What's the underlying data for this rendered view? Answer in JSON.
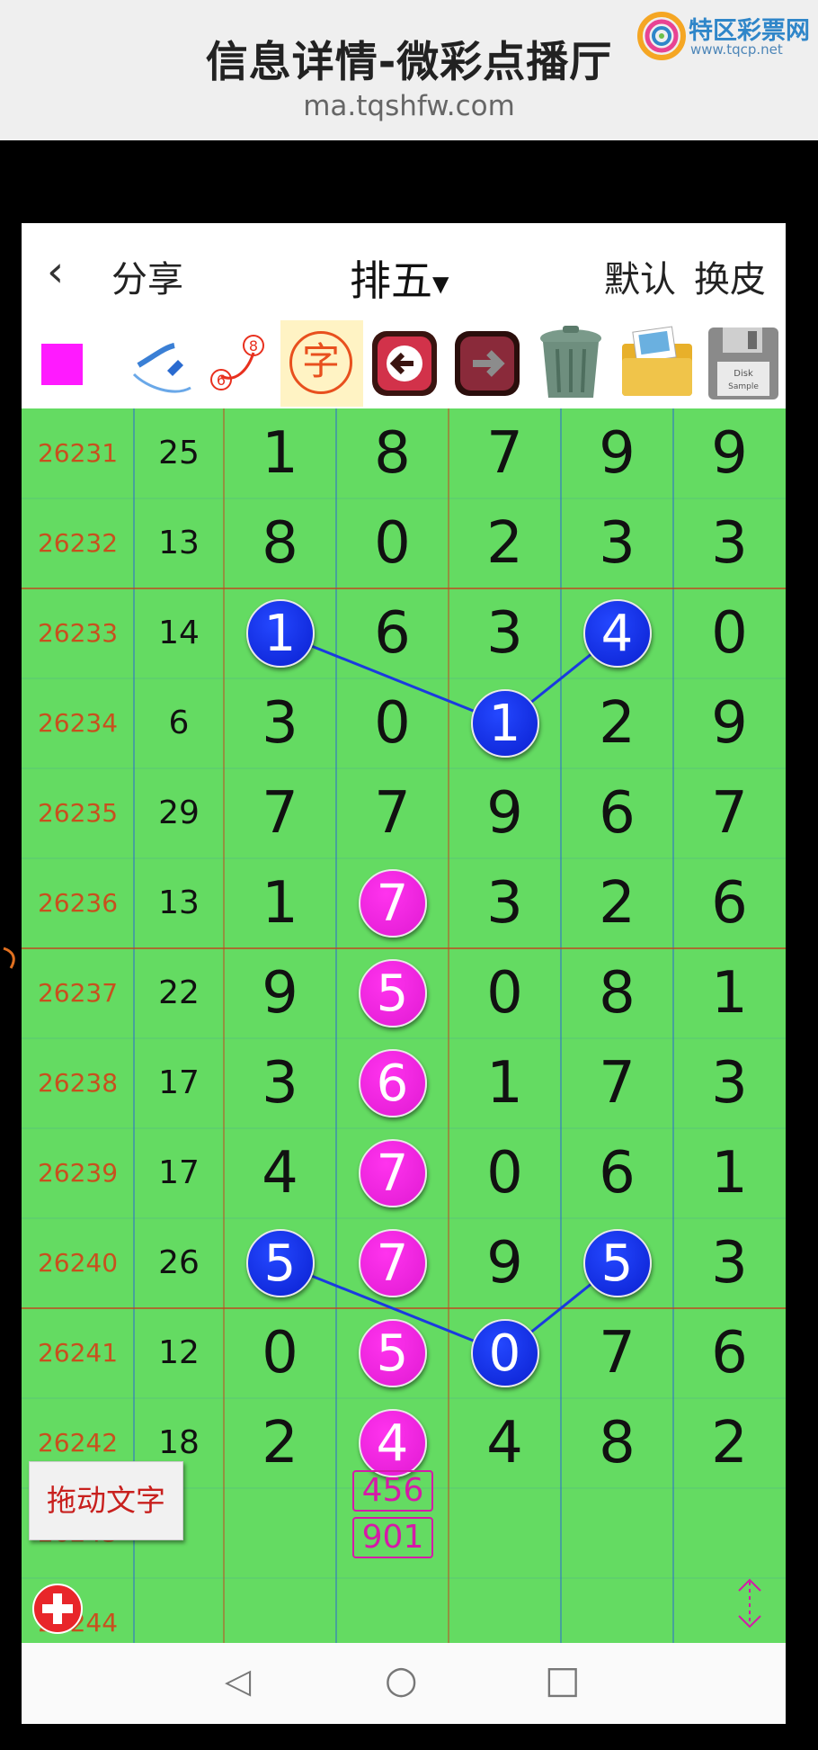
{
  "header": {
    "title": "信息详情-微彩点播厅",
    "url": "ma.tqshfw.com",
    "logo_name": "特区彩票网",
    "logo_url": "www.tqcp.net"
  },
  "nav": {
    "back_icon": "‹",
    "share": "分享",
    "title": "排五",
    "default": "默认",
    "skin": "换皮"
  },
  "toolbar": {
    "char_glyph": "字",
    "color_swatch": "#ff1aff",
    "curve_num_6": "6",
    "curve_num_8": "8",
    "floppy_label": "Disk",
    "floppy_sub": "Sample"
  },
  "grid": {
    "colors": {
      "bg": "#64db62",
      "issue": "#c8501e",
      "blue_ball": "#0a1fd0",
      "pink_ball": "#e01ad2",
      "row_line": "#c04a20",
      "col_line": "#2a6bd0"
    },
    "rows": [
      {
        "issue": "26231",
        "sum": "25",
        "digits": [
          "1",
          "8",
          "7",
          "9",
          "9"
        ]
      },
      {
        "issue": "26232",
        "sum": "13",
        "digits": [
          "8",
          "0",
          "2",
          "3",
          "3"
        ]
      },
      {
        "issue": "26233",
        "sum": "14",
        "digits": [
          "1",
          "6",
          "3",
          "4",
          "0"
        ]
      },
      {
        "issue": "26234",
        "sum": "6",
        "digits": [
          "3",
          "0",
          "1",
          "2",
          "9"
        ]
      },
      {
        "issue": "26235",
        "sum": "29",
        "digits": [
          "7",
          "7",
          "9",
          "6",
          "7"
        ]
      },
      {
        "issue": "26236",
        "sum": "13",
        "digits": [
          "1",
          "7",
          "3",
          "2",
          "6"
        ]
      },
      {
        "issue": "26237",
        "sum": "22",
        "digits": [
          "9",
          "5",
          "0",
          "8",
          "1"
        ]
      },
      {
        "issue": "26238",
        "sum": "17",
        "digits": [
          "3",
          "6",
          "1",
          "7",
          "3"
        ]
      },
      {
        "issue": "26239",
        "sum": "17",
        "digits": [
          "4",
          "7",
          "0",
          "6",
          "1"
        ]
      },
      {
        "issue": "26240",
        "sum": "26",
        "digits": [
          "5",
          "7",
          "9",
          "5",
          "3"
        ]
      },
      {
        "issue": "26241",
        "sum": "12",
        "digits": [
          "0",
          "5",
          "0",
          "7",
          "6"
        ]
      },
      {
        "issue": "26242",
        "sum": "18",
        "digits": [
          "2",
          "4",
          "4",
          "8",
          "2"
        ]
      },
      {
        "issue": "26243",
        "sum": "",
        "digits": [
          "",
          "",
          "",
          "",
          ""
        ]
      },
      {
        "issue": "26244",
        "sum": "",
        "digits": [
          "",
          "",
          "",
          "",
          ""
        ]
      }
    ],
    "balls": [
      {
        "row": 2,
        "col": 0,
        "color": "blue"
      },
      {
        "row": 3,
        "col": 2,
        "color": "blue"
      },
      {
        "row": 2,
        "col": 3,
        "color": "blue"
      },
      {
        "row": 5,
        "col": 1,
        "color": "pink"
      },
      {
        "row": 6,
        "col": 1,
        "color": "pink"
      },
      {
        "row": 7,
        "col": 1,
        "color": "pink"
      },
      {
        "row": 8,
        "col": 1,
        "color": "pink"
      },
      {
        "row": 9,
        "col": 1,
        "color": "pink"
      },
      {
        "row": 10,
        "col": 1,
        "color": "pink"
      },
      {
        "row": 11,
        "col": 1,
        "color": "pink"
      },
      {
        "row": 9,
        "col": 0,
        "color": "blue"
      },
      {
        "row": 10,
        "col": 2,
        "color": "blue"
      },
      {
        "row": 9,
        "col": 3,
        "color": "blue"
      }
    ],
    "lines": [
      {
        "from": [
          2,
          0
        ],
        "to": [
          3,
          2
        ]
      },
      {
        "from": [
          3,
          2
        ],
        "to": [
          2,
          3
        ]
      },
      {
        "from": [
          9,
          0
        ],
        "to": [
          10,
          2
        ]
      },
      {
        "from": [
          10,
          2
        ],
        "to": [
          9,
          3
        ]
      }
    ],
    "predictions": [
      "456",
      "901"
    ]
  },
  "overlay": {
    "drag_text": "拖动文字"
  },
  "system_nav": {
    "back": "◁",
    "home": "○",
    "recent": "□"
  }
}
